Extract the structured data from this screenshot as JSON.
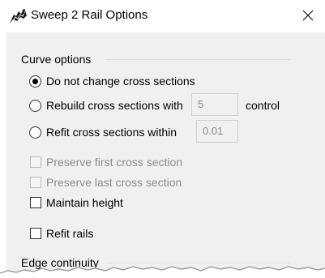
{
  "window": {
    "title": "Sweep 2 Rail Options",
    "close_glyph": "✕",
    "icon": "rhino-sweep-icon"
  },
  "curve_options": {
    "header": "Curve options",
    "radio_do_not_change": {
      "label": "Do not change cross sections",
      "checked": true
    },
    "radio_rebuild": {
      "label": "Rebuild cross sections with",
      "checked": false,
      "value": "5",
      "suffix": "control"
    },
    "radio_refit": {
      "label": "Refit cross sections within",
      "checked": false,
      "value": "0.01"
    },
    "preserve_first": {
      "label": "Preserve first cross section",
      "checked": false,
      "enabled": false
    },
    "preserve_last": {
      "label": "Preserve last cross section",
      "checked": false,
      "enabled": false
    },
    "maintain_height": {
      "label": "Maintain height",
      "checked": false,
      "enabled": true
    },
    "refit_rails": {
      "label": "Refit rails",
      "checked": false,
      "enabled": true
    }
  },
  "edge_continuity": {
    "header": "Edge continuity"
  },
  "colors": {
    "client_bg": "#f0f0f0",
    "disabled_text": "#8d8d8d",
    "group_line": "#dcdcdc"
  }
}
